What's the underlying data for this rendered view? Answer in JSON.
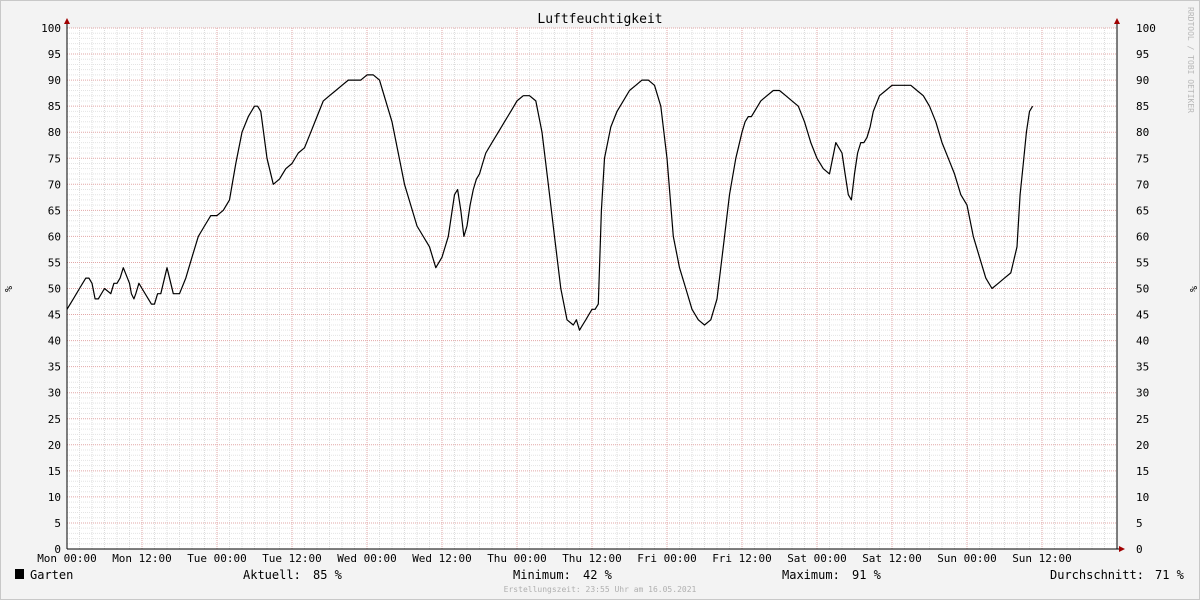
{
  "chart_data": {
    "type": "line",
    "title": "Luftfeuchtigkeit",
    "ylabel": "%",
    "ylim": [
      0,
      100
    ],
    "y_ticks": [
      0,
      5,
      10,
      15,
      20,
      25,
      30,
      35,
      40,
      45,
      50,
      55,
      60,
      65,
      70,
      75,
      80,
      85,
      90,
      95,
      100
    ],
    "xlim_hours": [
      0,
      168
    ],
    "x_tick_labels": [
      "Mon 00:00",
      "Mon 12:00",
      "Tue 00:00",
      "Tue 12:00",
      "Wed 00:00",
      "Wed 12:00",
      "Thu 00:00",
      "Thu 12:00",
      "Fri 00:00",
      "Fri 12:00",
      "Sat 00:00",
      "Sat 12:00",
      "Sun 00:00",
      "Sun 12:00"
    ],
    "grid": true,
    "series": [
      {
        "name": "Garten",
        "color": "#000000",
        "x_hours": [
          0,
          1,
          2,
          3,
          3.5,
          4,
          4.5,
          5,
          6,
          7,
          7.5,
          8,
          8.5,
          9,
          10,
          10.3,
          10.7,
          11,
          11.5,
          12,
          13,
          13.5,
          14,
          14.5,
          15,
          16,
          17,
          18,
          19,
          20,
          21,
          22,
          23,
          24,
          25,
          26,
          27,
          28,
          29,
          30,
          30.5,
          31,
          32,
          33,
          34,
          35,
          36,
          37,
          38,
          39,
          40,
          41,
          42,
          43,
          44,
          45,
          46,
          47,
          48,
          49,
          50,
          52,
          54,
          56,
          58,
          59,
          60,
          61,
          62,
          62.5,
          63,
          63.5,
          64,
          64.5,
          65,
          65.5,
          66,
          66.5,
          67,
          68,
          69,
          70,
          71,
          72,
          73,
          74,
          75,
          76,
          77,
          78,
          79,
          80,
          81,
          81.5,
          82,
          82.5,
          83,
          83.5,
          84,
          84.5,
          85,
          85.5,
          86,
          87,
          88,
          89,
          90,
          91,
          92,
          93,
          94,
          95,
          96,
          97,
          98,
          99,
          100,
          101,
          102,
          103,
          104,
          105,
          106,
          107,
          108,
          108.5,
          109,
          109.5,
          110,
          111,
          112,
          113,
          114,
          115,
          116,
          117,
          118,
          119,
          120,
          121,
          122,
          123,
          124,
          124.5,
          125,
          125.5,
          126,
          126.5,
          127,
          127.5,
          128,
          128.5,
          129,
          130,
          131,
          132,
          133,
          134,
          135,
          136,
          137,
          138,
          139,
          140,
          141,
          142,
          143,
          144,
          145,
          146,
          147,
          148,
          149,
          150,
          151,
          152,
          152.5,
          153,
          153.5,
          154,
          154.5,
          155,
          156,
          156.5,
          157,
          157.5,
          158,
          158.5,
          159,
          160,
          161,
          162,
          163,
          164,
          165,
          166,
          167,
          168
        ],
        "values": [
          46,
          48,
          50,
          52,
          52,
          51,
          48,
          48,
          50,
          49,
          51,
          51,
          52,
          54,
          51,
          49,
          48,
          49,
          51,
          50,
          48,
          47,
          47,
          49,
          49,
          54,
          49,
          49,
          52,
          56,
          60,
          62,
          64,
          64,
          65,
          67,
          74,
          80,
          83,
          85,
          85,
          84,
          75,
          70,
          71,
          73,
          74,
          76,
          77,
          80,
          83,
          86,
          87,
          88,
          89,
          90,
          90,
          90,
          91,
          91,
          90,
          82,
          70,
          62,
          58,
          54,
          56,
          60,
          68,
          69,
          65,
          60,
          62,
          66,
          69,
          71,
          72,
          74,
          76,
          78,
          80,
          82,
          84,
          86,
          87,
          87,
          86,
          80,
          70,
          60,
          50,
          44,
          43,
          44,
          42,
          43,
          44,
          45,
          46,
          46,
          47,
          65,
          75,
          81,
          84,
          86,
          88,
          89,
          90,
          90,
          89,
          85,
          75,
          60,
          54,
          50,
          46,
          44,
          43,
          44,
          48,
          58,
          68,
          75,
          80,
          82,
          83,
          83,
          84,
          86,
          87,
          88,
          88,
          87,
          86,
          85,
          82,
          78,
          75,
          73,
          72,
          78,
          76,
          72,
          68,
          67,
          72,
          76,
          78,
          78,
          79,
          81,
          84,
          87,
          88,
          89,
          89,
          89,
          89,
          88,
          87,
          85,
          82,
          78,
          75,
          72,
          68,
          66,
          60,
          56,
          52,
          50,
          51,
          52,
          53,
          58,
          68,
          74,
          80,
          84,
          85
        ]
      }
    ],
    "legend": {
      "series_label": "Garten",
      "current_label": "Aktuell:",
      "current_value": "85 %",
      "min_label": "Minimum:",
      "min_value": "42 %",
      "max_label": "Maximum:",
      "max_value": "91 %",
      "avg_label": "Durchschnitt:",
      "avg_value": "71 %"
    },
    "watermark": "RRDTOOL / TOBI OETIKER",
    "footer": "Erstellungszeit: 23:55 Uhr am 16.05.2021"
  }
}
